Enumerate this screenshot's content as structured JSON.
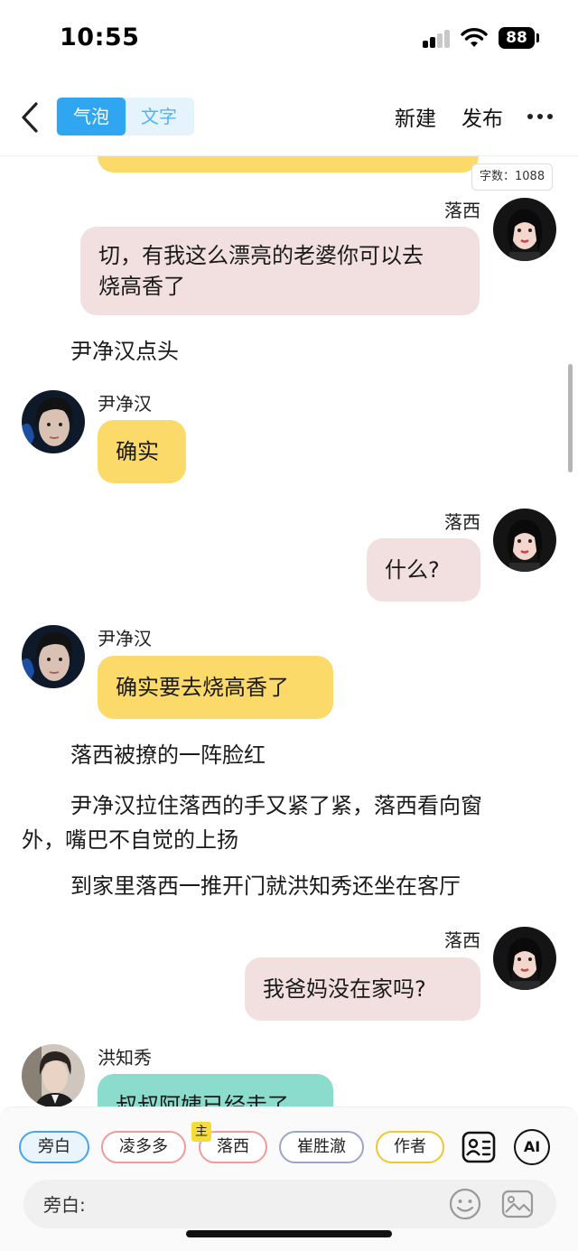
{
  "status_bar": {
    "time": "10:55",
    "battery": "88"
  },
  "nav": {
    "tabs": [
      {
        "label": "气泡",
        "active": true
      },
      {
        "label": "文字",
        "active": false
      }
    ],
    "new_label": "新建",
    "publish_label": "发布"
  },
  "word_count": "字数：1088",
  "messages": [
    {
      "type": "bubble",
      "speaker": "落西",
      "side": "right",
      "text_lines": [
        "切，有我这么漂亮的老婆你可以去",
        "烧高香了"
      ]
    },
    {
      "type": "narration",
      "text": "尹净汉点头"
    },
    {
      "type": "bubble",
      "speaker": "尹净汉",
      "side": "left",
      "text": "确实"
    },
    {
      "type": "bubble",
      "speaker": "落西",
      "side": "right",
      "text": "什么?"
    },
    {
      "type": "bubble",
      "speaker": "尹净汉",
      "side": "left",
      "text": "确实要去烧高香了"
    },
    {
      "type": "narration",
      "text": "落西被撩的一阵脸红"
    },
    {
      "type": "narration",
      "text_lines": [
        "尹净汉拉住落西的手又紧了紧，落西看向窗",
        "外，嘴巴不自觉的上扬"
      ]
    },
    {
      "type": "narration",
      "text": "到家里落西一推开门就洪知秀还坐在客厅"
    },
    {
      "type": "bubble",
      "speaker": "落西",
      "side": "right",
      "text": "我爸妈没在家吗?"
    },
    {
      "type": "bubble",
      "speaker": "洪知秀",
      "side": "left",
      "text": "叔叔阿姨已经走了"
    }
  ],
  "characters": [
    {
      "label": "旁白",
      "selected": true
    },
    {
      "label": "凌多多"
    },
    {
      "label": "落西",
      "badge": "主"
    },
    {
      "label": "崔胜澈"
    },
    {
      "label": "作者"
    }
  ],
  "ai_label": "AI",
  "input": {
    "label": "旁白:"
  },
  "colors": {
    "accent": "#2fa6ef",
    "left_bubble": "#fcda6a",
    "right_bubble": "#f2e0e0",
    "teal_bubble": "#8cdccd"
  }
}
